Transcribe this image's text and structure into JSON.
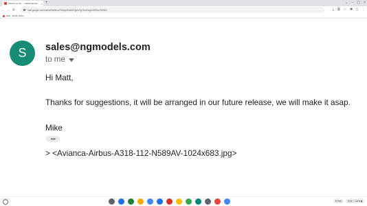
{
  "browser": {
    "tab": {
      "title": "Pictures of the ... mattfinchphoto",
      "close_icon": "×"
    },
    "new_tab_icon": "+",
    "window_controls": [
      "⌄",
      "–",
      "▢",
      "×"
    ],
    "nav": {
      "back": "←",
      "forward": "→",
      "reload": "⟳"
    },
    "url": "mail.google.com/mail/u/0/#inbox/FMfcgzGtwMKHjpKrZgTbcllZxrgmGlDbwVvMBXl",
    "toolbar_icons": [
      "⤓",
      "⧉",
      "☆",
      "✱",
      "▯",
      "⋮"
    ],
    "bookmark": {
      "label": "Web · Model Airline..."
    }
  },
  "email": {
    "avatar_letter": "S",
    "avatar_color": "#168c72",
    "sender": "sales@ngmodels.com",
    "recipient": "to me",
    "greeting": "Hi Matt,",
    "message": "Thanks for suggestions, it will be arranged in our future release, we will make it asap.",
    "signature": "Mike",
    "trimmed_label": "•••",
    "quoted": "> <Avianca-Airbus-A318-112-N589AV-1024x683.jpg>"
  },
  "shelf": {
    "apps": [
      {
        "name": "chrome",
        "color": "#5f6368"
      },
      {
        "name": "files",
        "color": "#1a73e8"
      },
      {
        "name": "sheets",
        "color": "#188038"
      },
      {
        "name": "slides",
        "color": "#f9ab00"
      },
      {
        "name": "calendar",
        "color": "#4285f4"
      },
      {
        "name": "docs",
        "color": "#1a73e8"
      },
      {
        "name": "pdf",
        "color": "#d93025"
      },
      {
        "name": "keep",
        "color": "#fbbc04"
      },
      {
        "name": "photos",
        "color": "#34a853"
      },
      {
        "name": "meet",
        "color": "#00897b"
      },
      {
        "name": "settings",
        "color": "#5f6368"
      },
      {
        "name": "music",
        "color": "#e8453c"
      },
      {
        "name": "chrome-browser",
        "color": "#4285f4"
      }
    ],
    "date": "8 Feb",
    "status": "9:41  ◔ CA  ▾ ▮"
  }
}
